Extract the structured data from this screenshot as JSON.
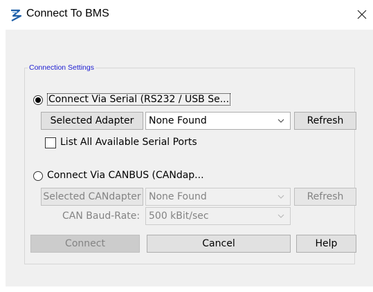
{
  "window": {
    "title": "Connect To BMS",
    "icon": "app-logo-icon",
    "close_icon": "close-icon"
  },
  "group": {
    "title": "Connection Settings"
  },
  "serial": {
    "radio_label": "Connect Via Serial (RS232 / USB Se...",
    "selected": true,
    "adapter_button": "Selected Adapter",
    "adapter_value": "None Found",
    "refresh_button": "Refresh",
    "list_all_label": "List All Available Serial Ports",
    "list_all_checked": false
  },
  "canbus": {
    "radio_label": "Connect Via CANBUS (CANdap...",
    "selected": false,
    "adapter_button": "Selected CANdapter",
    "adapter_value": "None Found",
    "refresh_button": "Refresh",
    "baud_label": "CAN Baud-Rate:",
    "baud_value": "500 kBit/sec"
  },
  "actions": {
    "connect": "Connect",
    "cancel": "Cancel",
    "help": "Help"
  }
}
